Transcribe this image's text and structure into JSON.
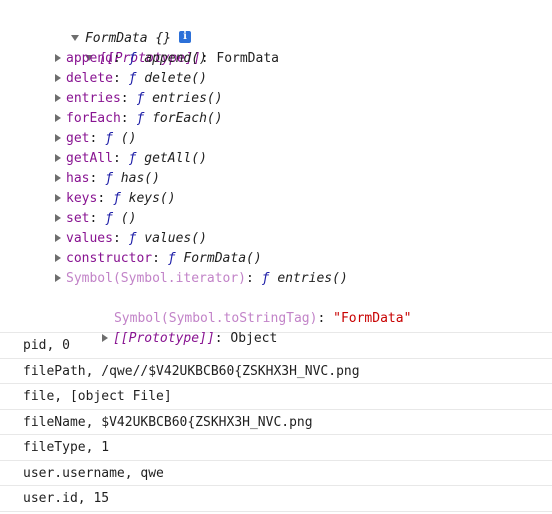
{
  "formdata": {
    "title": "FormData {}",
    "info_icon": "i",
    "prototype_key": "[[Prototype]]",
    "prototype_value": "FormData",
    "props": [
      {
        "key": "append",
        "kw": "ƒ",
        "fn": "append()"
      },
      {
        "key": "delete",
        "kw": "ƒ",
        "fn": "delete()"
      },
      {
        "key": "entries",
        "kw": "ƒ",
        "fn": "entries()"
      },
      {
        "key": "forEach",
        "kw": "ƒ",
        "fn": "forEach()"
      },
      {
        "key": "get",
        "kw": "ƒ",
        "fn": "()"
      },
      {
        "key": "getAll",
        "kw": "ƒ",
        "fn": "getAll()"
      },
      {
        "key": "has",
        "kw": "ƒ",
        "fn": "has()"
      },
      {
        "key": "keys",
        "kw": "ƒ",
        "fn": "keys()"
      },
      {
        "key": "set",
        "kw": "ƒ",
        "fn": "()"
      },
      {
        "key": "values",
        "kw": "ƒ",
        "fn": "values()"
      },
      {
        "key": "constructor",
        "kw": "ƒ",
        "fn": "FormData()"
      },
      {
        "key": "Symbol(Symbol.iterator)",
        "kw": "ƒ",
        "fn": "entries()"
      }
    ],
    "tostringtag_key": "Symbol(Symbol.toStringTag)",
    "tostringtag_value": "\"FormData\"",
    "inner_prototype_key": "[[Prototype]]",
    "inner_prototype_value": "Object"
  },
  "logs": [
    "pid, 0",
    "filePath, /qwe//$V42UKBCB60{ZSKHX3H_NVC.png",
    "file, [object File]",
    "fileName, $V42UKBCB60{ZSKHX3H_NVC.png",
    "fileType, 1",
    "user.username, qwe",
    "user.id, 15"
  ],
  "colors": {
    "key": "#881391",
    "key_dim": "#c283c8",
    "function_keyword": "#1a1aa6",
    "string": "#c80000",
    "info_icon_bg": "#2c70d8"
  }
}
